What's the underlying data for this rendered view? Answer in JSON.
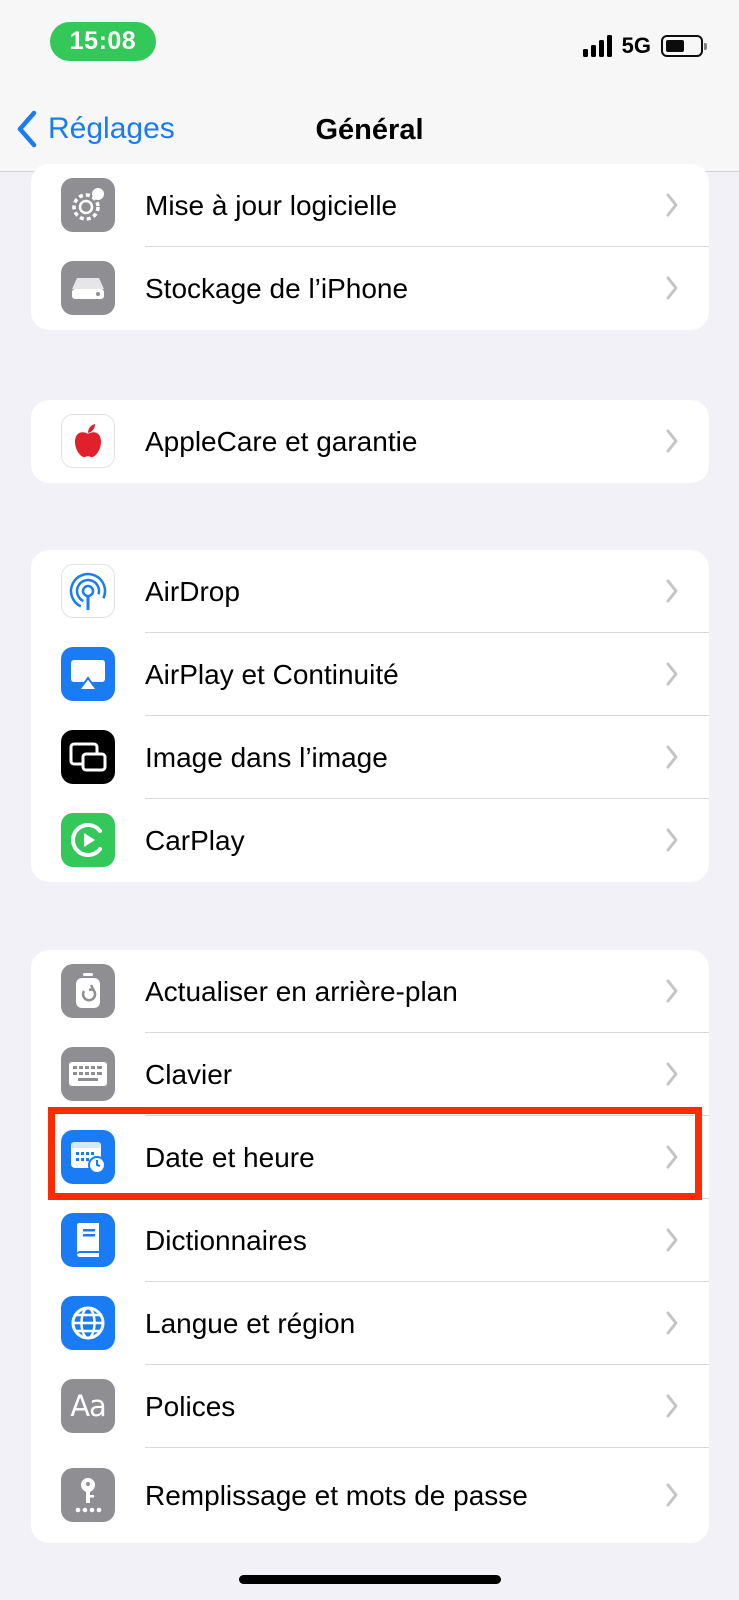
{
  "status_bar": {
    "time": "15:08",
    "network": "5G",
    "battery_level": 0.55,
    "signal_bars": 4
  },
  "nav": {
    "back_label": "Réglages",
    "title": "Général"
  },
  "groups": [
    {
      "rows": [
        {
          "label": "Mise à jour logicielle",
          "icon": "gear-badge-icon",
          "icon_color": "#8e8e93"
        },
        {
          "label": "Stockage de l’iPhone",
          "icon": "storage-drive-icon",
          "icon_color": "#8e8e93"
        }
      ]
    },
    {
      "rows": [
        {
          "label": "AppleCare et garantie",
          "icon": "apple-logo-icon",
          "icon_color": "#e0212b"
        }
      ]
    },
    {
      "rows": [
        {
          "label": "AirDrop",
          "icon": "airdrop-icon",
          "icon_color": "#1a7cf4"
        },
        {
          "label": "AirPlay et Continuité",
          "icon": "airplay-icon",
          "icon_color": "#1a7cf4"
        },
        {
          "label": "Image dans l’image",
          "icon": "picture-in-picture-icon",
          "icon_color": "#000000"
        },
        {
          "label": "CarPlay",
          "icon": "carplay-icon",
          "icon_color": "#34c759"
        }
      ]
    },
    {
      "rows": [
        {
          "label": "Actualiser en arrière-plan",
          "icon": "background-refresh-icon",
          "icon_color": "#8e8e93"
        },
        {
          "label": "Clavier",
          "icon": "keyboard-icon",
          "icon_color": "#8e8e93"
        },
        {
          "label": "Date et heure",
          "icon": "calendar-clock-icon",
          "icon_color": "#1a7cf4"
        },
        {
          "label": "Dictionnaires",
          "icon": "book-icon",
          "icon_color": "#1a7cf4"
        },
        {
          "label": "Langue et région",
          "icon": "globe-icon",
          "icon_color": "#1a7cf4"
        },
        {
          "label": "Polices",
          "icon": "fonts-icon",
          "icon_color": "#8e8e93"
        },
        {
          "label": "Remplissage et mots de passe",
          "icon": "key-icon",
          "icon_color": "#8e8e93"
        }
      ]
    }
  ],
  "highlight_color": "#ff2a00",
  "accent_color": "#1a7cf4"
}
